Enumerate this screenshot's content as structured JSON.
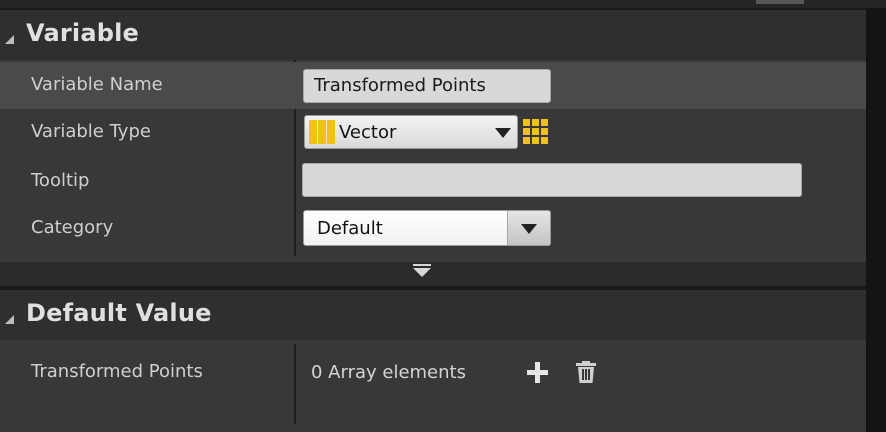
{
  "sections": {
    "variable": {
      "title": "Variable",
      "rows": {
        "name": {
          "label": "Variable Name",
          "value": "Transformed Points"
        },
        "type": {
          "label": "Variable Type",
          "value": "Vector",
          "icon": "grid-icon"
        },
        "tooltip": {
          "label": "Tooltip",
          "value": "",
          "placeholder": ""
        },
        "category": {
          "label": "Category",
          "value": "Default"
        }
      }
    },
    "default_value": {
      "title": "Default Value",
      "rows": {
        "points": {
          "label": "Transformed Points",
          "value": "0 Array elements"
        }
      }
    }
  },
  "colors": {
    "background": "#1a1a1a",
    "panel": "#383838",
    "header": "#2f2f2f",
    "highlight_row": "#4a4a4a",
    "vector_accent": "#f2c30c"
  },
  "icons": {
    "collapse_arrow": "triangle-collapse-icon",
    "type_pill": "vector-type-icon",
    "array_toggle": "grid-icon",
    "dropdown": "chevron-down-icon",
    "expand_bar": "chevron-down-icon",
    "add": "plus-icon",
    "remove_all": "trash-icon"
  }
}
